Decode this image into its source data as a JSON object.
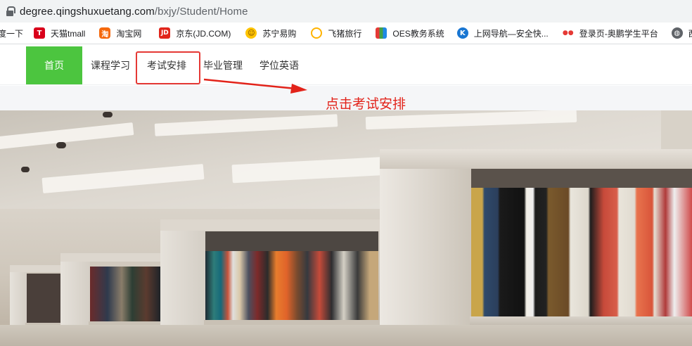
{
  "address_bar": {
    "url_host": "degree.qingshuxuetang.com",
    "url_path": "/bxjy/Student/Home"
  },
  "bookmarks": [
    {
      "label": "度一下",
      "icon": "baidu-icon"
    },
    {
      "label": "天猫tmall",
      "icon": "tmall-icon"
    },
    {
      "label": "淘宝网",
      "icon": "taobao-icon"
    },
    {
      "label": "京东(JD.COM)",
      "icon": "jd-icon"
    },
    {
      "label": "苏宁易购",
      "icon": "suning-icon"
    },
    {
      "label": "飞猪旅行",
      "icon": "fliggy-icon"
    },
    {
      "label": "OES教务系统",
      "icon": "oes-icon"
    },
    {
      "label": "上网导航—安全快...",
      "icon": "k-icon"
    },
    {
      "label": "登录页-奥鹏学生平台",
      "icon": "aopeng-icon"
    },
    {
      "label": "西南",
      "icon": "globe-icon"
    }
  ],
  "nav": {
    "items": [
      {
        "label": "首页",
        "active": true
      },
      {
        "label": "课程学习",
        "active": false
      },
      {
        "label": "考试安排",
        "active": false
      },
      {
        "label": "毕业管理",
        "active": false
      },
      {
        "label": "学位英语",
        "active": false
      }
    ]
  },
  "annotation": {
    "text": "点击考试安排",
    "color": "#e2231a"
  },
  "colors": {
    "nav_active": "#4cc53f",
    "highlight": "#e53935"
  }
}
